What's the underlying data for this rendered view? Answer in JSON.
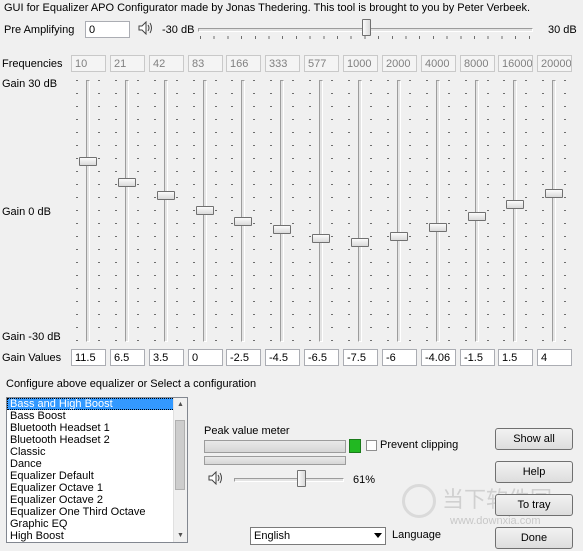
{
  "credit": "GUI for Equalizer APO Configurator made by Jonas Thedering. This tool is brought to you by Peter Verbeek.",
  "pre_amp": {
    "label": "Pre Amplifying",
    "value": "0",
    "min_label": "-30 dB",
    "max_label": "30 dB",
    "level": 0.5,
    "icon": "speaker-icon"
  },
  "frequencies": {
    "label": "Frequencies",
    "values": [
      "10",
      "21",
      "42",
      "83",
      "166",
      "333",
      "577",
      "1000",
      "2000",
      "4000",
      "8000",
      "16000",
      "20000"
    ]
  },
  "gain_axis": {
    "top": "Gain 30 dB",
    "middle": "Gain 0 dB",
    "bottom": "Gain -30 dB"
  },
  "gains": {
    "label": "Gain Values",
    "values": [
      "11.5",
      "6.5",
      "3.5",
      "0",
      "-2.5",
      "-4.5",
      "-6.5",
      "-7.5",
      "-6",
      "-4.06",
      "-1.5",
      "1.5",
      "4"
    ],
    "numeric": [
      11.5,
      6.5,
      3.5,
      0,
      -2.5,
      -4.5,
      -6.5,
      -7.5,
      -6,
      -4.06,
      -1.5,
      1.5,
      4
    ],
    "range_db": [
      -30,
      30
    ]
  },
  "config": {
    "label": "Configure above equalizer or Select a configuration",
    "items": [
      "Bass and High Boost",
      "Bass Boost",
      "Bluetooth Headset 1",
      "Bluetooth Headset 2",
      "Classic",
      "Dance",
      "Equalizer Default",
      "Equalizer Octave 1",
      "Equalizer Octave 2",
      "Equalizer One Third Octave",
      "Graphic EQ",
      "High Boost"
    ],
    "selected_index": 0
  },
  "peak_meter": {
    "label": "Peak value meter",
    "prevent_clipping": "Prevent clipping",
    "prevent_clipping_checked": false,
    "indicator_color": "#22b822"
  },
  "volume": {
    "value_label": "61%",
    "level": 0.61,
    "icon": "speaker-icon"
  },
  "language": {
    "selected": "English",
    "label": "Language"
  },
  "buttons": {
    "show_all": "Show all",
    "help": "Help",
    "to_tray": "To tray",
    "done": "Done"
  },
  "watermark": {
    "brand": "当下软件园",
    "url": "www.downxia.com"
  }
}
